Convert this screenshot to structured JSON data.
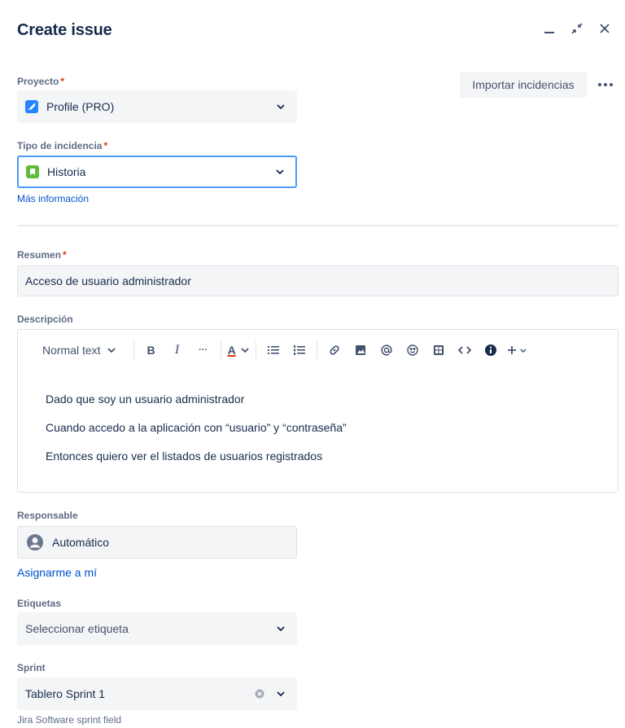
{
  "dialog": {
    "title": "Create issue"
  },
  "header_actions": {
    "import_label": "Importar incidencias",
    "more_label": "•••"
  },
  "fields": {
    "project": {
      "label": "Proyecto",
      "required": "*",
      "value": "Profile (PRO)",
      "icon": "rocket-icon"
    },
    "issue_type": {
      "label": "Tipo de incidencia",
      "required": "*",
      "value": "Historia",
      "icon": "story-icon",
      "more_info": "Más información"
    },
    "summary": {
      "label": "Resumen",
      "required": "*",
      "value": "Acceso de usuario administrador"
    },
    "description": {
      "label": "Descripción",
      "toolbar": {
        "text_style": "Normal text",
        "bold": "B",
        "italic": "I",
        "more": "···",
        "text_color": "A"
      },
      "lines": [
        "Dado que soy un usuario administrador",
        "Cuando accedo a la aplicación con “usuario” y “contraseña”",
        "Entonces quiero ver el listados de usuarios registrados"
      ]
    },
    "assignee": {
      "label": "Responsable",
      "value": "Automático",
      "assign_me": "Asignarme a mí"
    },
    "labels": {
      "label": "Etiquetas",
      "placeholder": "Seleccionar etiqueta"
    },
    "sprint": {
      "label": "Sprint",
      "value": "Tablero Sprint 1",
      "hint": "Jira Software sprint field"
    }
  },
  "colors": {
    "accent": "#0052cc",
    "focus": "#4c9aff",
    "required": "#de350b",
    "project_icon": "#2684ff",
    "story_icon": "#63ba3c"
  }
}
